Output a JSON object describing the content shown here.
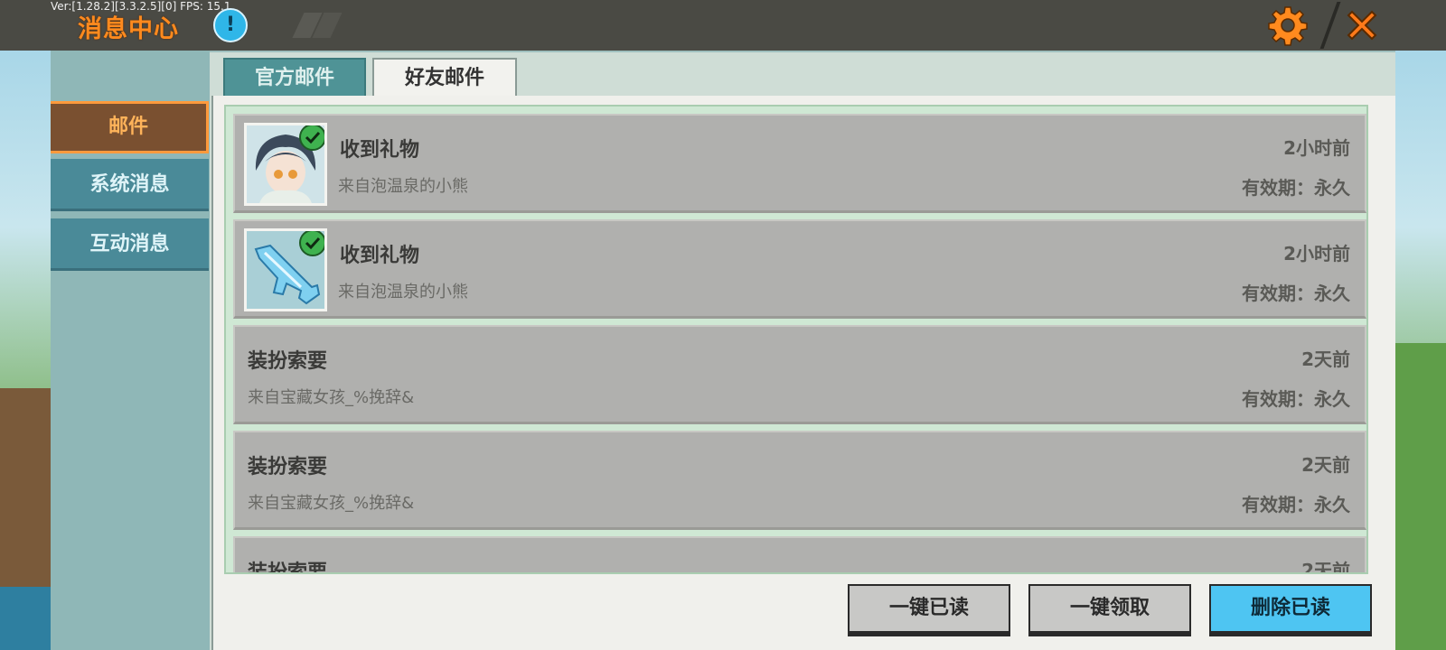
{
  "version_text": "Ver:[1.28.2][3.3.2.5][0] FPS: 15.1",
  "header": {
    "title": "消息中心",
    "info_icon": "info-icon",
    "info_symbol": "!",
    "settings_icon": "gear-icon",
    "close_icon": "close-icon"
  },
  "sidebar": {
    "items": [
      {
        "label": "邮件",
        "active": true
      },
      {
        "label": "系统消息",
        "active": false
      },
      {
        "label": "互动消息",
        "active": false
      }
    ]
  },
  "tabs": [
    {
      "label": "官方邮件",
      "active": false
    },
    {
      "label": "好友邮件",
      "active": true
    }
  ],
  "mails": [
    {
      "title": "收到礼物",
      "from": "来自泡温泉的小熊",
      "time": "2小时前",
      "expiry": "有效期：永久",
      "icon": "avatar-character-icon",
      "claimed": true
    },
    {
      "title": "收到礼物",
      "from": "来自泡温泉的小熊",
      "time": "2小时前",
      "expiry": "有效期：永久",
      "icon": "ice-gun-icon",
      "claimed": true
    },
    {
      "title": "装扮索要",
      "from": "来自宝藏女孩_%挽辞&",
      "time": "2天前",
      "expiry": "有效期：永久"
    },
    {
      "title": "装扮索要",
      "from": "来自宝藏女孩_%挽辞&",
      "time": "2天前",
      "expiry": "有效期：永久"
    },
    {
      "title": "装扮索要",
      "from": "",
      "time": "2天前",
      "expiry": ""
    }
  ],
  "actions": {
    "mark_all_read": "一键已读",
    "claim_all": "一键领取",
    "delete_read": "删除已读"
  },
  "colors": {
    "accent_orange": "#ff8a1e",
    "primary_blue": "#4ec5f2",
    "tab_teal": "#4f9396"
  }
}
